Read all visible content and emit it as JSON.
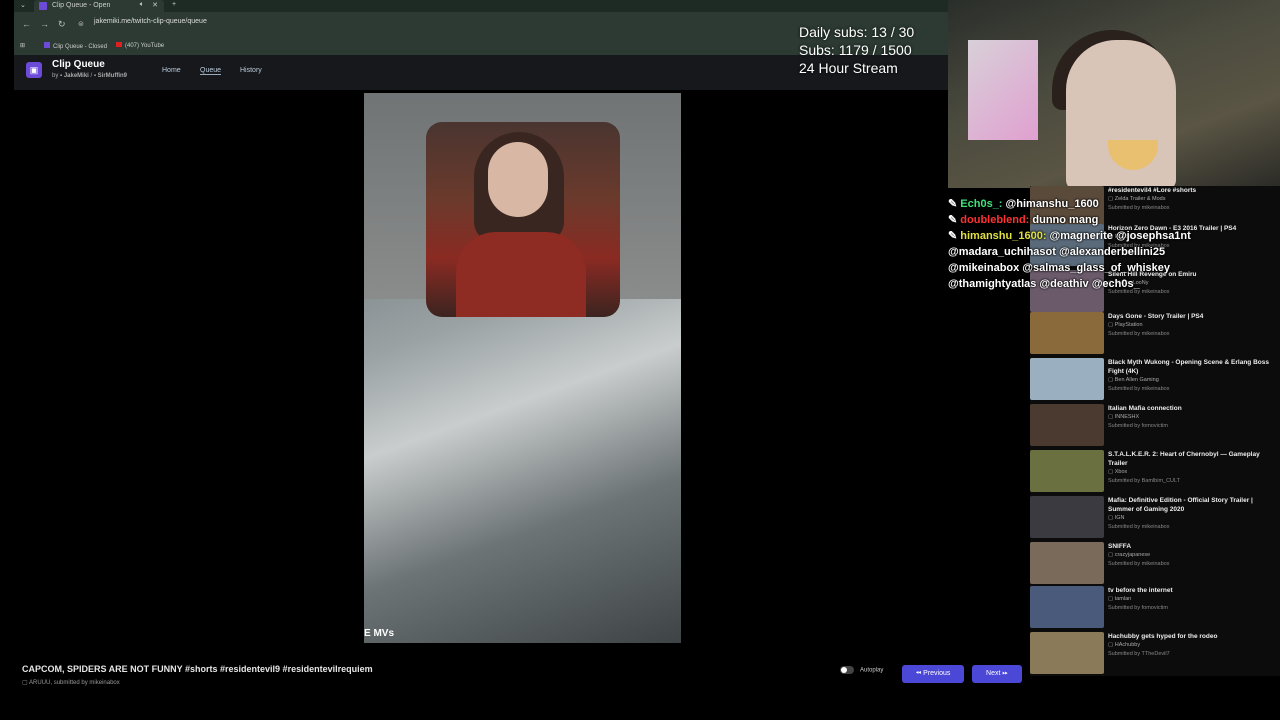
{
  "browser": {
    "tab_title": "Clip Queue - Open",
    "url": "jakemiki.me/twitch-clip-queue/queue",
    "bookmarks": [
      "Clip Queue - Closed",
      "(407) YouTube"
    ]
  },
  "app": {
    "title": "Clip Queue",
    "subtitle_by": "by",
    "author1": "JakeMiki",
    "author2": "SirMuffin9",
    "nav": [
      "Home",
      "Queue",
      "History"
    ]
  },
  "overlay": {
    "daily_subs": "Daily subs: 13 / 30",
    "subs": "Subs: 1179 / 1500",
    "stream": "24 Hour Stream"
  },
  "player": {
    "caption": "E MVs",
    "clip_title": "CAPCOM, SPIDERS ARE NOT FUNNY #shorts #residentevil9 #residentevilrequiem",
    "channel": "ARUUU",
    "submitted_by": "submitted by",
    "submitter": "mikeinabox",
    "autoplay_label": "Autoplay",
    "prev_label": "Previous",
    "next_label": "Next"
  },
  "chat": [
    {
      "user": "Ech0s_:",
      "user_color": "#3fe07a",
      "msg": "@himanshu_1600"
    },
    {
      "user": "doubleblend:",
      "user_color": "#ff3030",
      "msg": "dunno mang"
    },
    {
      "user": "himanshu_1600:",
      "user_color": "#e0e040",
      "msg": "@magnerite @josephsa1nt"
    },
    {
      "user": "",
      "user_color": "#ffffff",
      "msg": "@madara_uchihasot @alexanderbellini25"
    },
    {
      "user": "",
      "user_color": "#ffffff",
      "msg": "@mikeinabox @salmas_glass_of_whiskey"
    },
    {
      "user": "",
      "user_color": "#ffffff",
      "msg": "@thamightyatlas @deathiv @ech0s_"
    }
  ],
  "queue": [
    {
      "title": "#residentevil4 #Lore #shorts",
      "channel": "Zelda Trailer & Mods",
      "submitter": "Submitted by mikeinabox",
      "thumb": "#5a4a3a"
    },
    {
      "title": "Horizon Zero Dawn - E3 2016 Trailer | PS4",
      "channel": "PlayStation",
      "submitter": "Submitted by mikeinabox",
      "thumb": "#5a6a7a"
    },
    {
      "title": "Silent Hill Revenge on Emiru",
      "channel": "Wacky LooNy",
      "submitter": "Submitted by mikeinabox",
      "thumb": "#6a5a6a"
    },
    {
      "title": "Days Gone - Story Trailer | PS4",
      "channel": "PlayStation",
      "submitter": "Submitted by mikeinabox",
      "thumb": "#8a6a3a"
    },
    {
      "title": "Black Myth Wukong - Opening Scene & Erlang Boss Fight (4K)",
      "channel": "Ben Allen Gaming",
      "submitter": "Submitted by mikeinabox",
      "thumb": "#9ab0c0"
    },
    {
      "title": "Italian Mafia connection",
      "channel": "INNESHX",
      "submitter": "Submitted by fomovictim",
      "thumb": "#4a3a30"
    },
    {
      "title": "S.T.A.L.K.E.R. 2: Heart of Chernobyl — Gameplay Trailer",
      "channel": "Xbox",
      "submitter": "Submitted by Bamlbim_CULT",
      "thumb": "#6a7040"
    },
    {
      "title": "Mafia: Definitive Edition - Official Story Trailer | Summer of Gaming 2020",
      "channel": "IGN",
      "submitter": "Submitted by mikeinabox",
      "thumb": "#3a3a40"
    },
    {
      "title": "SNIFFA",
      "channel": "crazyjapanese",
      "submitter": "Submitted by mikeinabox",
      "thumb": "#7a6a5a"
    },
    {
      "title": "tv before the internet",
      "channel": "tamlan",
      "submitter": "Submitted by fomovictim",
      "thumb": "#4a5a7a"
    },
    {
      "title": "Hachubby gets hyped for the rodeo",
      "channel": "HAchubby",
      "submitter": "Submitted by TTheDevil7",
      "thumb": "#8a7a5a"
    }
  ]
}
